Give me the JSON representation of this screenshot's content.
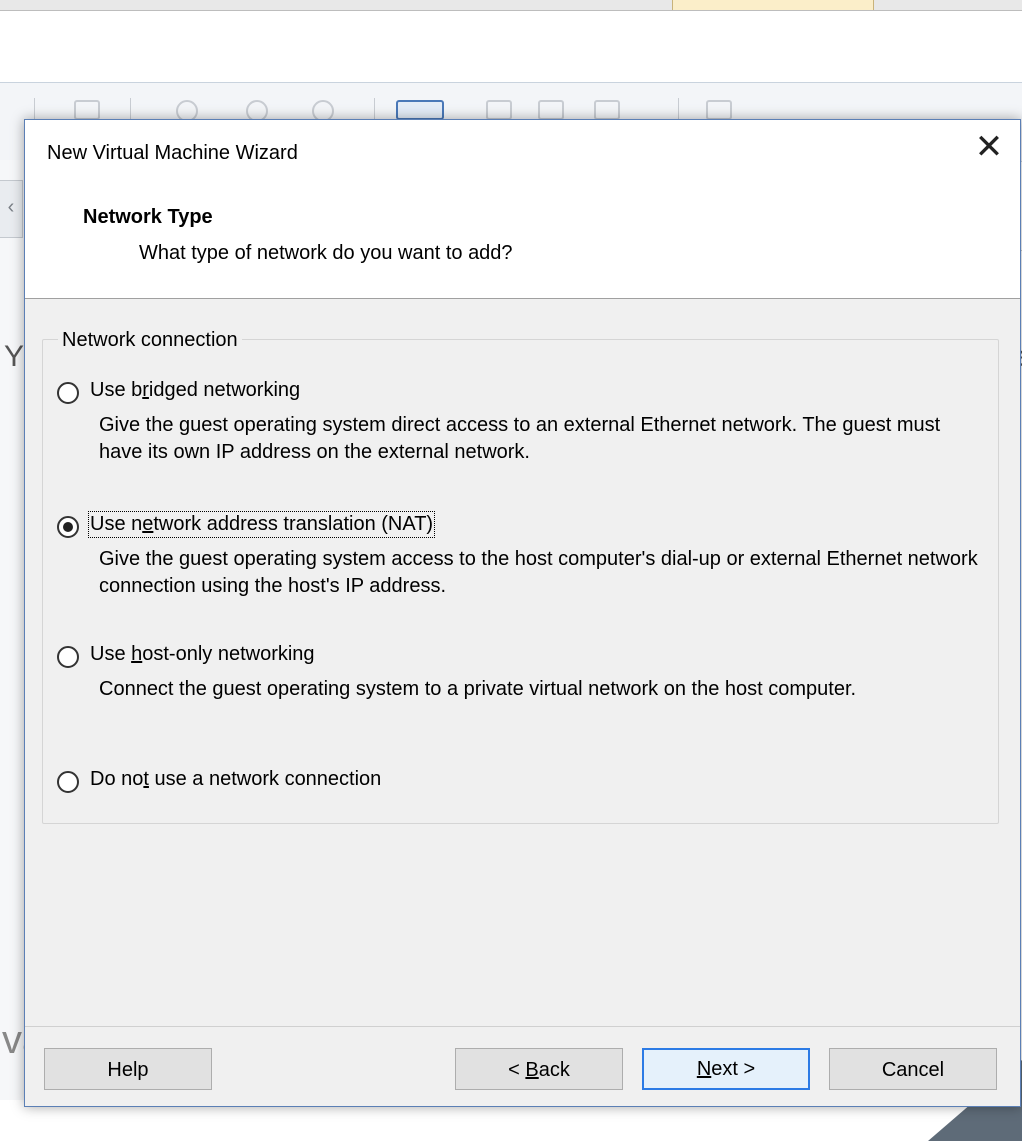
{
  "dialog": {
    "title": "New Virtual Machine Wizard",
    "close_symbol": "✕",
    "header_title": "Network Type",
    "header_subtitle": "What type of network do you want to add?",
    "group_label": "Network connection",
    "options": [
      {
        "pre": "Use b",
        "key": "r",
        "post": "idged networking",
        "description": "Give the guest operating system direct access to an external Ethernet network. The guest must have its own IP address on the external network.",
        "selected": false
      },
      {
        "pre": "Use n",
        "key": "e",
        "post": "twork address translation (NAT)",
        "description": "Give the guest operating system access to the host computer's dial-up or external Ethernet network connection using the host's IP address.",
        "selected": true
      },
      {
        "pre": "Use ",
        "key": "h",
        "post": "ost-only networking",
        "description": "Connect the guest operating system to a private virtual network on the host computer.",
        "selected": false
      },
      {
        "pre": "Do no",
        "key": "t",
        "post": " use a network connection",
        "description": "",
        "selected": false
      }
    ],
    "buttons": {
      "help": "Help",
      "back": {
        "pre": "< ",
        "key": "B",
        "post": "ack"
      },
      "next": {
        "pre": "",
        "key": "N",
        "post": "ext >"
      },
      "cancel": "Cancel"
    }
  },
  "background": {
    "left_tab_glyph": "‹",
    "left_letter": "Y",
    "left_bottom_letters": "va",
    "right_letter": "e"
  },
  "colors": {
    "accent": "#2c7be5",
    "dialog_bg": "#f0f0f0",
    "header_bg": "#ffffff"
  }
}
